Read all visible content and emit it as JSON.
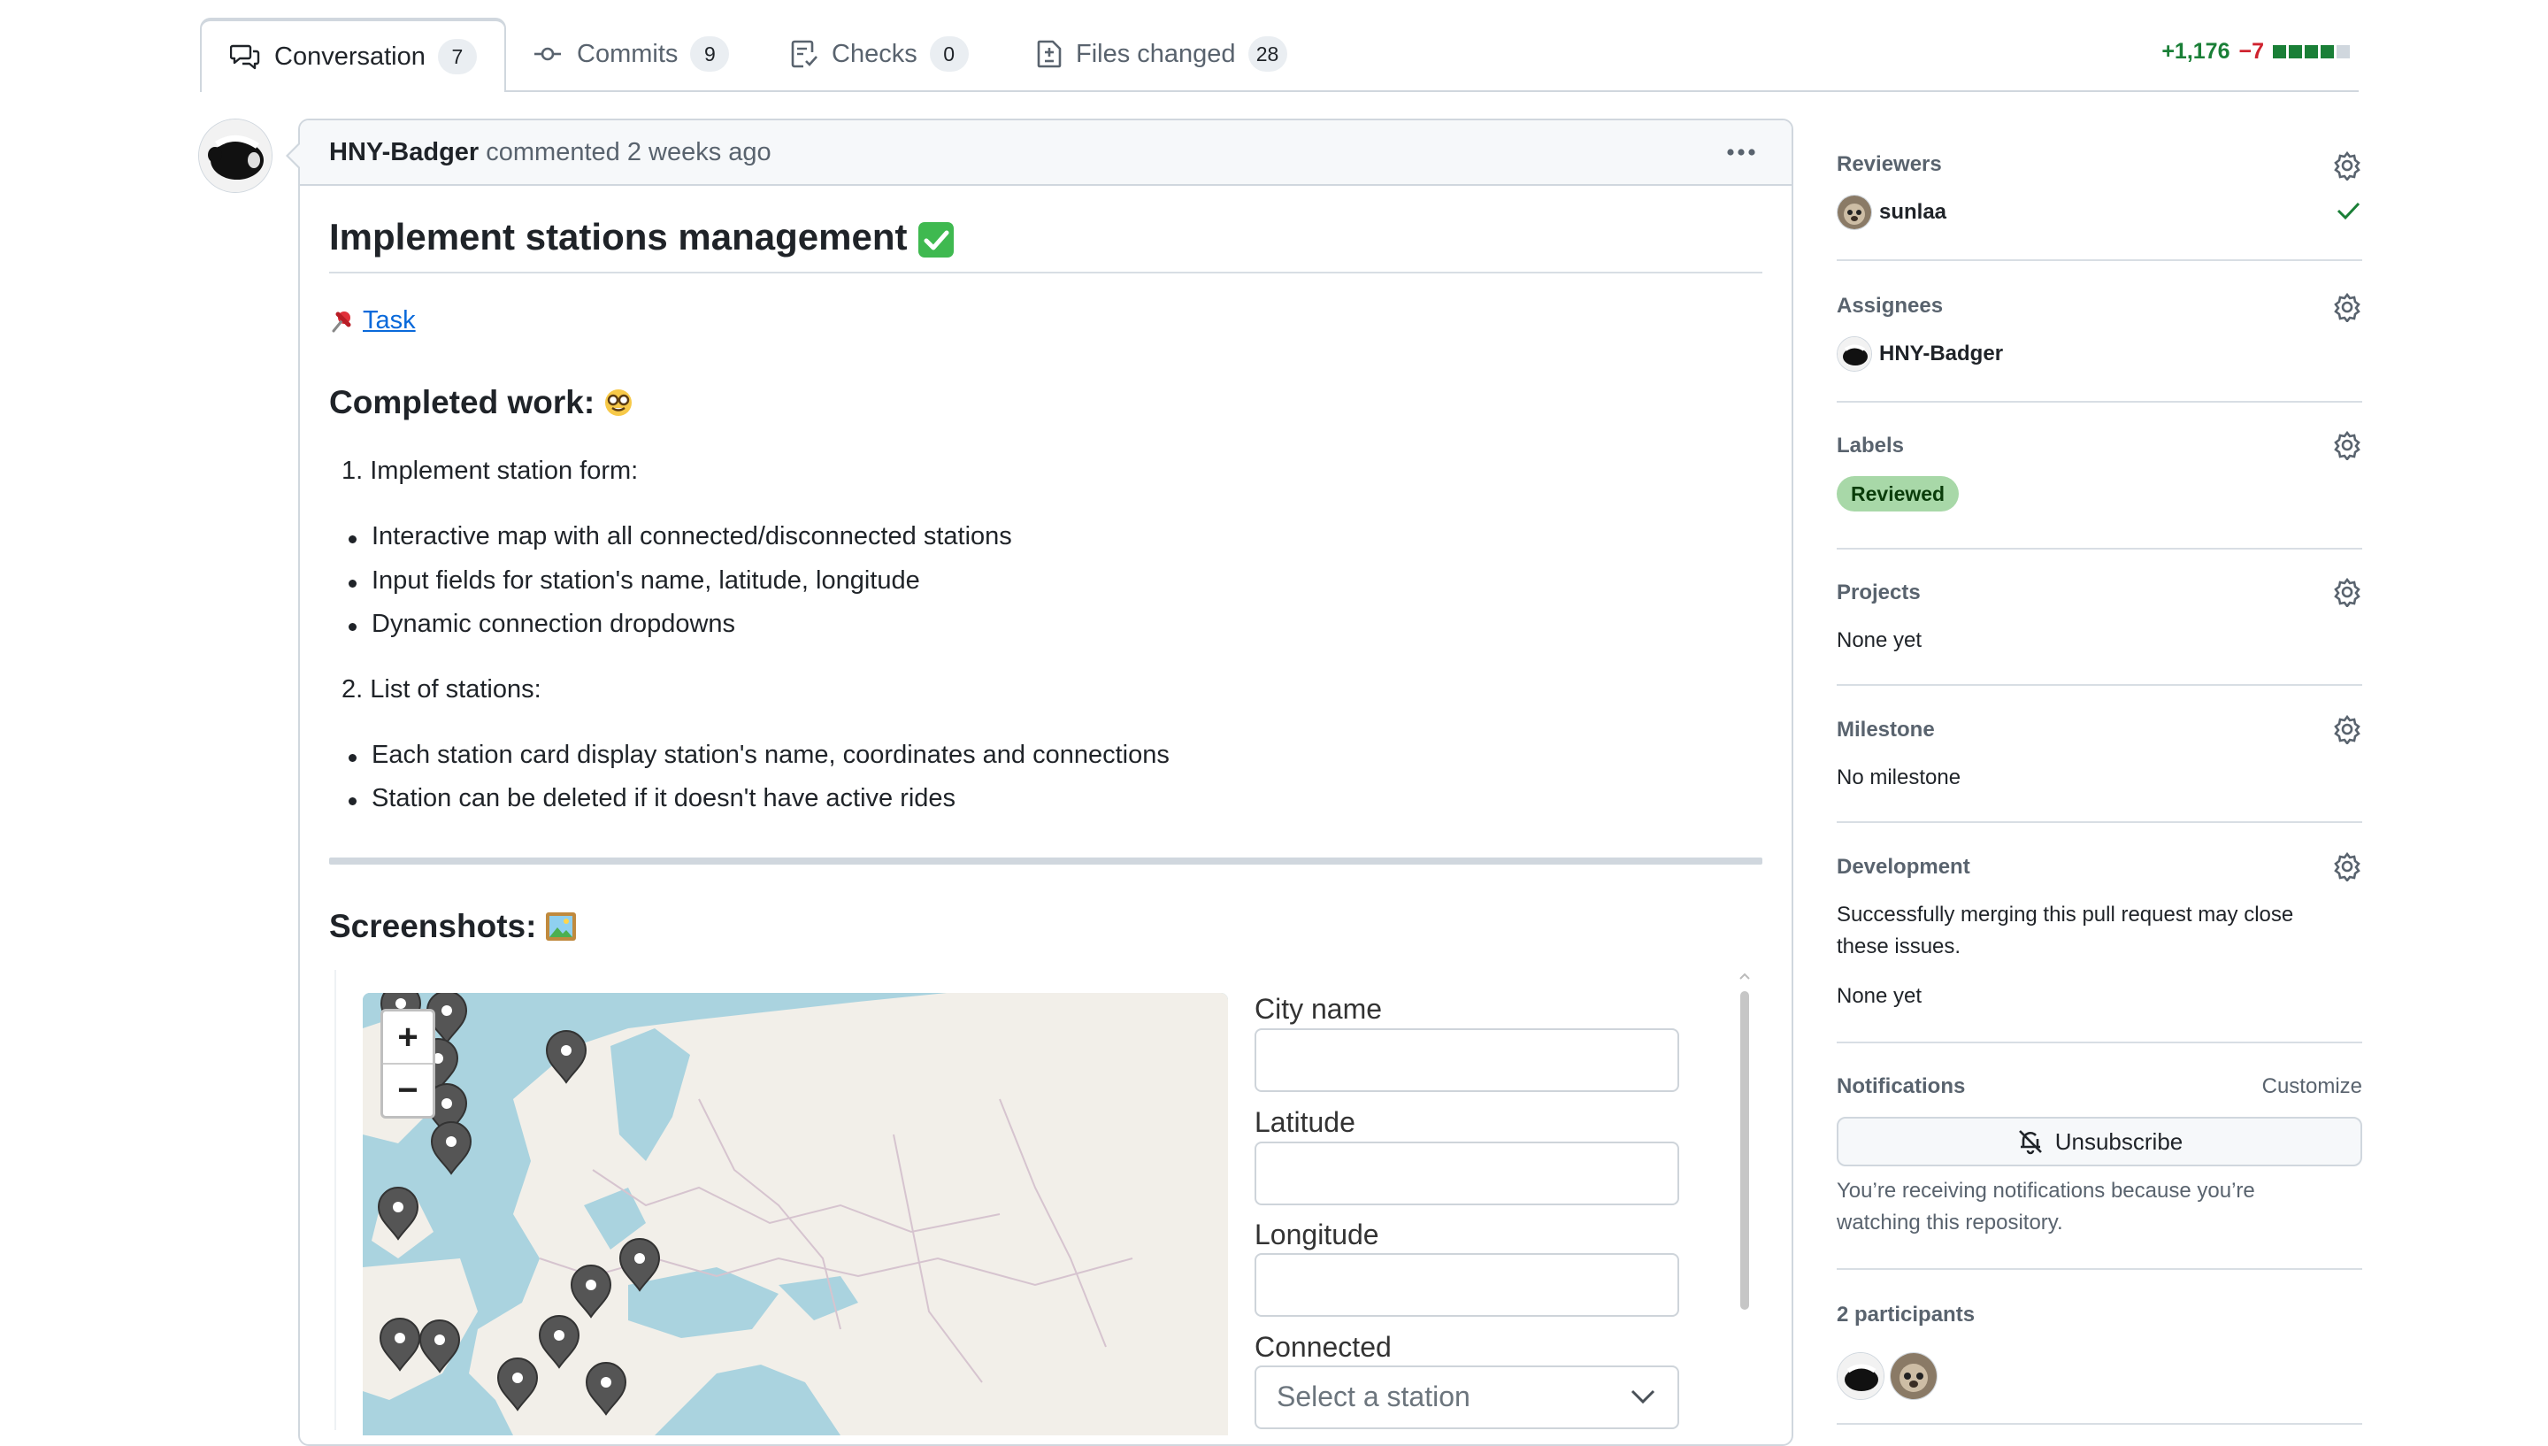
{
  "tabs": [
    {
      "label": "Conversation",
      "count": "7",
      "icon": "comment-discussion-icon",
      "active": true
    },
    {
      "label": "Commits",
      "count": "9",
      "icon": "git-commit-icon",
      "active": false
    },
    {
      "label": "Checks",
      "count": "0",
      "icon": "checklist-icon",
      "active": false
    },
    {
      "label": "Files changed",
      "count": "28",
      "icon": "file-diff-icon",
      "active": false
    }
  ],
  "diffstat": {
    "additions": "+1,176",
    "deletions": "−7",
    "colors": {
      "add": "#1a7f37",
      "del": "#cf222e",
      "neutral": "#d0d7de"
    }
  },
  "comment": {
    "author": "HNY-Badger",
    "action": "commented 2 weeks ago",
    "title": "Implement stations management",
    "title_emoji": "check-mark-button-emoji",
    "task_link": "Task",
    "task_emoji": "pushpin-emoji",
    "completed_heading": "Completed work:",
    "completed_emoji": "nerd-face-emoji",
    "item1": "1. Implement station form:",
    "item1_bullets": [
      "Interactive map with all connected/disconnected stations",
      "Input fields for station's name, latitude, longitude",
      "Dynamic connection dropdowns"
    ],
    "item2": "2. List of stations:",
    "item2_bullets": [
      "Each station card display station's name, coordinates and connections",
      "Station can be deleted if it doesn't have active rides"
    ],
    "screenshots_heading": "Screenshots:",
    "screenshots_emoji": "framed-picture-emoji"
  },
  "embedded_form": {
    "zoom_in": "+",
    "zoom_out": "−",
    "city_label": "City name",
    "lat_label": "Latitude",
    "lng_label": "Longitude",
    "connected_label": "Connected",
    "select_placeholder": "Select a station"
  },
  "sidebar": {
    "reviewers": {
      "title": "Reviewers",
      "name": "sunlaa",
      "status_icon": "check-icon"
    },
    "assignees": {
      "title": "Assignees",
      "name": "HNY-Badger"
    },
    "labels": {
      "title": "Labels",
      "label": "Reviewed",
      "color": "#a8d8a8"
    },
    "projects": {
      "title": "Projects",
      "value": "None yet"
    },
    "milestone": {
      "title": "Milestone",
      "value": "No milestone"
    },
    "development": {
      "title": "Development",
      "line1": "Successfully merging this pull request may close",
      "line2": "these issues.",
      "value": "None yet"
    },
    "notifications": {
      "title": "Notifications",
      "customize": "Customize",
      "button": "Unsubscribe",
      "line1": "You’re receiving notifications because you’re",
      "line2": "watching this repository."
    },
    "participants": {
      "title": "2 participants"
    }
  }
}
